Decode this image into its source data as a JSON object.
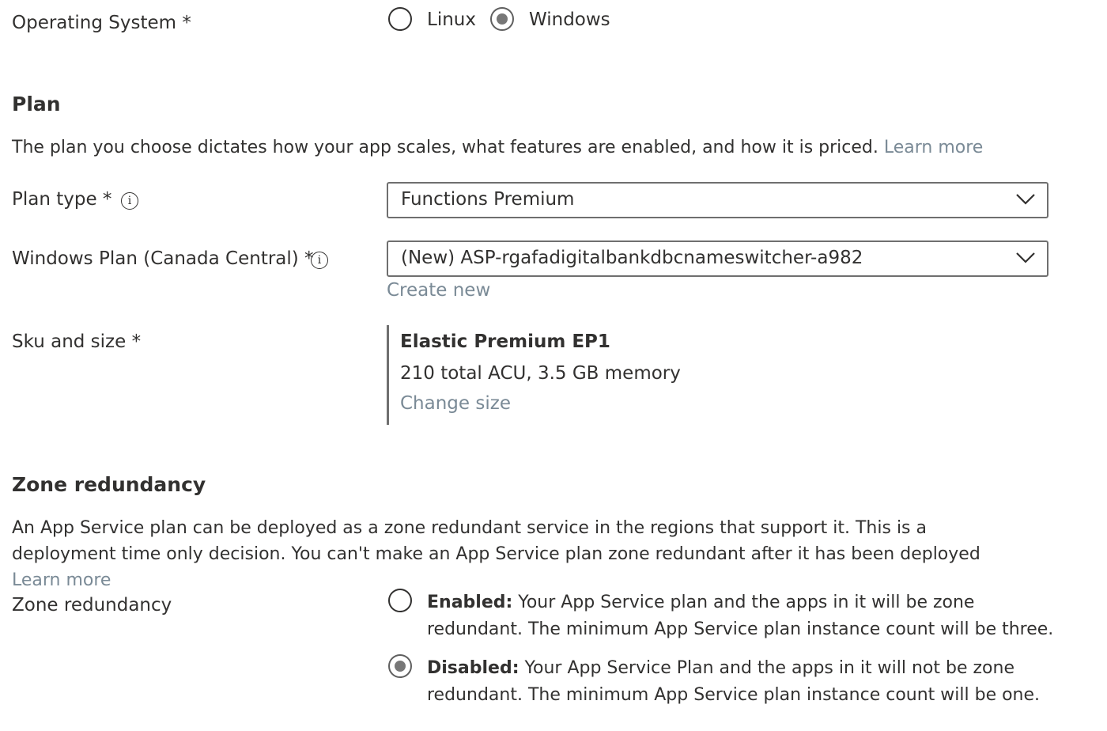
{
  "os": {
    "label": "Operating System *",
    "options": [
      {
        "label": "Linux",
        "checked": false
      },
      {
        "label": "Windows",
        "checked": true
      }
    ]
  },
  "plan": {
    "heading": "Plan",
    "description": "The plan you choose dictates how your app scales, what features are enabled, and how it is priced.",
    "learn_more": "Learn more",
    "plan_type": {
      "label": "Plan type *",
      "info_icon": "i",
      "value": "Functions Premium"
    },
    "windows_plan": {
      "label": "Windows Plan (Canada Central) *",
      "info_icon": "i",
      "value": "(New) ASP-rgafadigitalbankdbcnameswitcher-a982",
      "create_new": "Create new"
    },
    "sku": {
      "label": "Sku and size *",
      "name": "Elastic Premium EP1",
      "details": "210 total ACU, 3.5 GB memory",
      "change_size": "Change size"
    }
  },
  "zone": {
    "heading": "Zone redundancy",
    "description": "An App Service plan can be deployed as a zone redundant service in the regions that support it. This is a deployment time only decision. You can't make an App Service plan zone redundant after it has been deployed",
    "learn_more": "Learn more",
    "label": "Zone redundancy",
    "options": [
      {
        "title": "Enabled:",
        "text": "Your App Service plan and the apps in it will be zone redundant. The minimum App Service plan instance count will be three.",
        "checked": false
      },
      {
        "title": "Disabled:",
        "text": "Your App Service Plan and the apps in it will not be zone redundant. The minimum App Service plan instance count will be one.",
        "checked": true
      }
    ]
  },
  "colors": {
    "text": "#323130",
    "link": "#7a8a96",
    "border": "#6f6f6f"
  }
}
